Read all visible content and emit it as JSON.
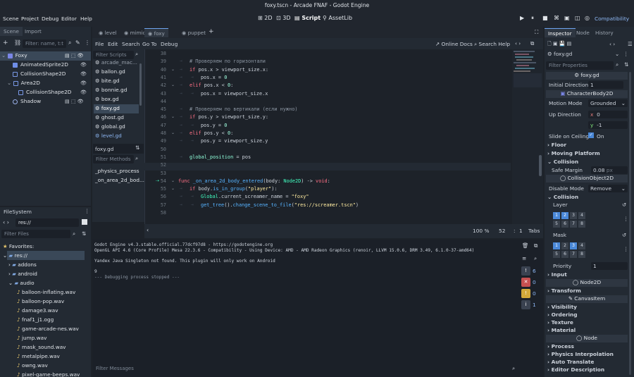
{
  "window_title": "foxy.tscn - Arcade FNAF - Godot Engine",
  "menu": [
    "Scene",
    "Project",
    "Debug",
    "Editor",
    "Help"
  ],
  "workspaces": [
    "2D",
    "3D",
    "Script",
    "AssetLib"
  ],
  "renderer": "Compatibility",
  "scene_panel": {
    "tabs": [
      "Scene",
      "Import"
    ],
    "filter_placeholder": "Filter: name, t:t",
    "nodes": [
      "Foxy",
      "AnimatedSprite2D",
      "CollisionShape2D",
      "Area2D",
      "CollisionShape2D",
      "Shadow"
    ]
  },
  "filesystem": {
    "title": "FileSystem",
    "path": "res://",
    "filter_placeholder": "Filter Files",
    "items": [
      "Favorites:",
      "res://",
      "addons",
      "android",
      "audio",
      "balloon-inflating.wav",
      "balloon-pop.wav",
      "damage3.wav",
      "fnaf1_j1.ogg",
      "game-arcade-nes.wav",
      "jump.wav",
      "mask_sound.wav",
      "metalpipe.wav",
      "owng.wav",
      "pixel-game-beeps.wav"
    ]
  },
  "script_tabs": [
    "level",
    "mimic",
    "foxy",
    "puppet"
  ],
  "script_menu": [
    "File",
    "Edit",
    "Search",
    "Go To",
    "Debug"
  ],
  "online_docs": "Online Docs",
  "search_help": "Search Help",
  "scripts_filter": "Filter Scripts",
  "scripts": [
    "arcade_mac...",
    "ballon.gd",
    "bite.gd",
    "bonnie.gd",
    "box.gd",
    "foxy.gd",
    "ghost.gd",
    "global.gd",
    "level.gd"
  ],
  "current_script": "foxy.gd",
  "methods_filter": "Filter Methods",
  "methods": [
    "_physics_process",
    "_on_area_2d_bod..."
  ],
  "code_lines": [
    {
      "n": "38",
      "t": ""
    },
    {
      "n": "39",
      "t": "# Проверяем по горизонтали"
    },
    {
      "n": "40",
      "t": "if pos.x > viewport_size.x:"
    },
    {
      "n": "41",
      "t": "pos.x = 0"
    },
    {
      "n": "42",
      "t": "elif pos.x < 0:"
    },
    {
      "n": "43",
      "t": "pos.x = viewport_size.x"
    },
    {
      "n": "44",
      "t": ""
    },
    {
      "n": "45",
      "t": "# Проверяем по вертикали (если нужно)"
    },
    {
      "n": "46",
      "t": "if pos.y > viewport_size.y:"
    },
    {
      "n": "47",
      "t": "pos.y = 0"
    },
    {
      "n": "48",
      "t": "elif pos.y < 0:"
    },
    {
      "n": "49",
      "t": "pos.y = viewport_size.y"
    },
    {
      "n": "50",
      "t": ""
    },
    {
      "n": "51",
      "t": "global_position = pos"
    },
    {
      "n": "52",
      "t": ""
    },
    {
      "n": "53",
      "t": ""
    },
    {
      "n": "54",
      "t": "func _on_area_2d_body_entered(body: Node2D) -> void:"
    },
    {
      "n": "55",
      "t": "if body.is_in_group(\"player\"):"
    },
    {
      "n": "56",
      "t": "Global.current_screamer_name = \"foxy\""
    },
    {
      "n": "57",
      "t": "get_tree().change_scene_to_file(\"res://screamer.tscn\")"
    },
    {
      "n": "58",
      "t": ""
    }
  ],
  "status": {
    "zoom": "100 %",
    "line": "52",
    "col": "1",
    "indent": "Tabs"
  },
  "output": {
    "lines": [
      "Godot Engine v4.3.stable.official.77dcf97d8 - https://godotengine.org",
      "OpenGL API 4.6 (Core Profile) Mesa 22.3.6 - Compatibility - Using Device: AMD - AMD Radeon Graphics (renoir, LLVM 15.0.6, DRM 3.49, 6.1.0-37-amd64)",
      "",
      "Yandex Java Singleton not found. This plugin will only work on Android",
      "",
      "9",
      "--- Debugging process stopped ---"
    ],
    "filter": "Filter Messages",
    "counts": [
      "6",
      "0",
      "0",
      "1"
    ]
  },
  "inspector": {
    "tabs": [
      "Inspector",
      "Node",
      "History"
    ],
    "resource": "foxy.gd",
    "filter": "Filter Properties",
    "script_header": "foxy.gd",
    "initial_direction_label": "Initial Direction",
    "initial_direction": "1",
    "characterbody": "CharacterBody2D",
    "motion_mode_label": "Motion Mode",
    "motion_mode": "Grounded",
    "up_direction_label": "Up Direction",
    "up_x": "0",
    "up_y": "-1",
    "slide_label": "Slide on Ceiling",
    "slide_value": "On",
    "floor": "Floor",
    "moving_platform": "Moving Platform",
    "collision": "Collision",
    "safe_margin_label": "Safe Margin",
    "safe_margin": "0.08",
    "safe_unit": "px",
    "collisionobject": "CollisionObject2D",
    "disable_mode_label": "Disable Mode",
    "disable_mode": "Remove",
    "collision2": "Collision",
    "layer": "Layer",
    "mask": "Mask",
    "layer_bits": [
      "1",
      "2",
      "3",
      "4",
      "5",
      "6",
      "7",
      "8"
    ],
    "priority_label": "Priority",
    "priority": "1",
    "input": "Input",
    "node2d": "Node2D",
    "transform": "Transform",
    "canvasitem": "CanvasItem",
    "visibility": "Visibility",
    "ordering": "Ordering",
    "texture": "Texture",
    "material": "Material",
    "node": "Node",
    "process": "Process",
    "physics_interp": "Physics Interpolation",
    "auto_translate": "Auto Translate",
    "editor_desc": "Editor Description"
  }
}
